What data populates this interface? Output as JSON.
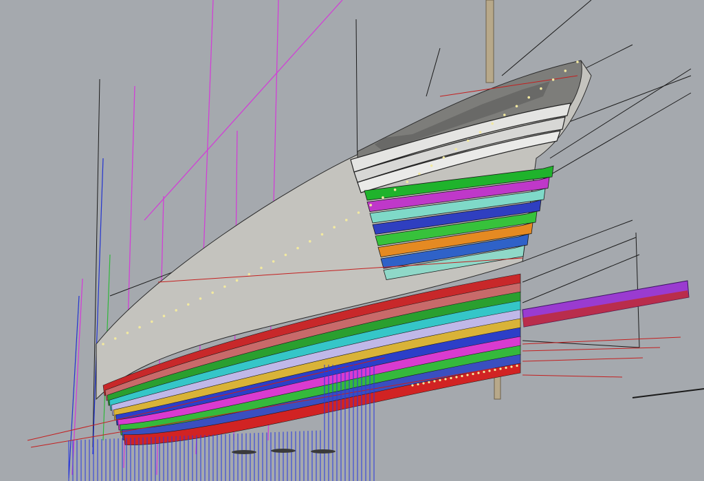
{
  "viewport": {
    "background": "#a5a9ae",
    "hull_shell_color": "#c4c3be",
    "upper_strake_colors": [
      "#1fb32c",
      "#bf38c9",
      "#7fd9c8",
      "#2f3fc0",
      "#37c23b",
      "#e58a22",
      "#2f62c8",
      "#8fd8c8"
    ],
    "lower_strake_colors": [
      "#c8282a",
      "#c86a6a",
      "#2a9f2f",
      "#35c6c8",
      "#c0b8e8",
      "#d9b338",
      "#2c3fc8",
      "#d93bd0",
      "#35b93c",
      "#3a4fc0",
      "#d12323"
    ],
    "outline_colors": {
      "construction_magenta": "#d13fd6",
      "construction_blue": "#2233d0",
      "construction_black": "#1a1a1a",
      "construction_red": "#c41e1e",
      "wireframe_blue": "#2836e0"
    }
  }
}
